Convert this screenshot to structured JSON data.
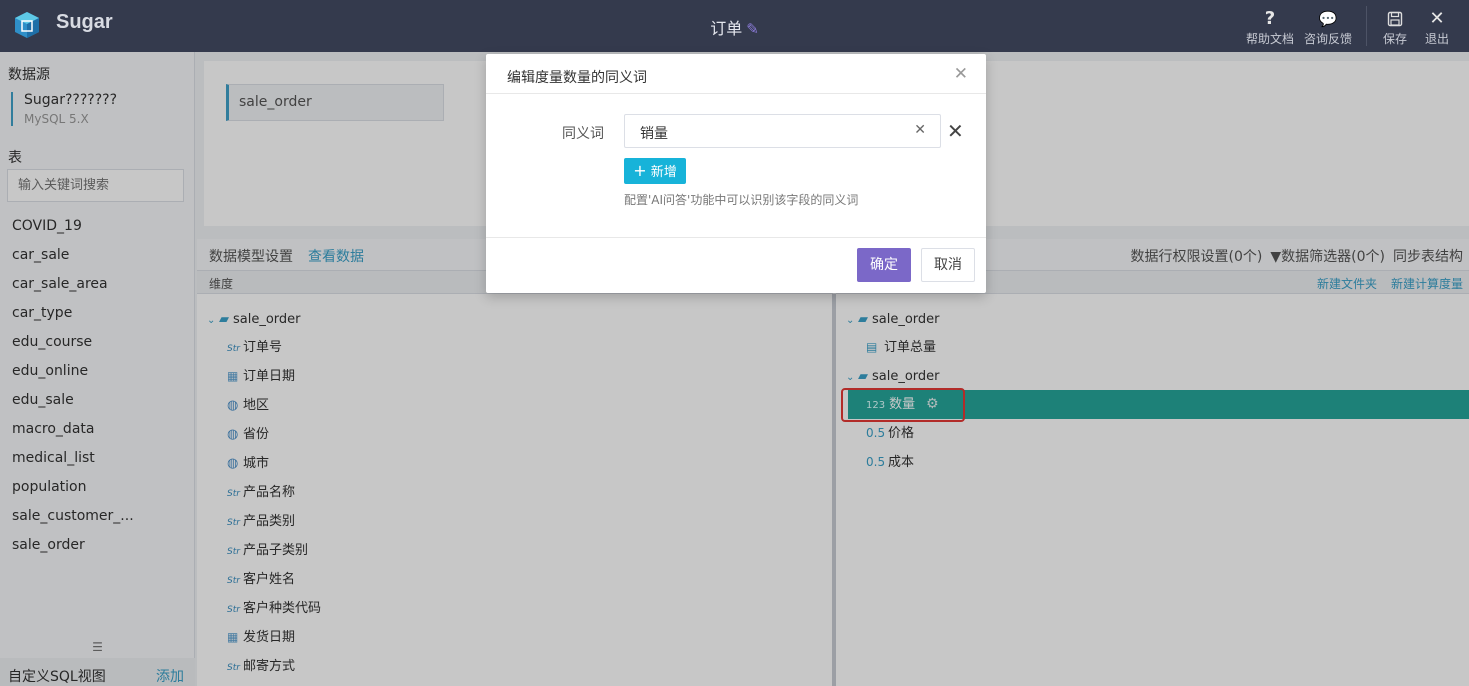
{
  "app": {
    "brand": "Sugar",
    "page_title": "订单"
  },
  "header_actions": [
    {
      "label": "帮助文档",
      "icon": "question-icon"
    },
    {
      "label": "咨询反馈",
      "icon": "chat-icon"
    },
    {
      "label": "保存",
      "icon": "save-icon"
    },
    {
      "label": "退出",
      "icon": "close-icon"
    }
  ],
  "sidebar": {
    "datasource_label": "数据源",
    "datasource_name": "Sugar???????",
    "datasource_type": "MySQL 5.X",
    "table_label": "表",
    "search_placeholder": "输入关键词搜索",
    "tables": [
      "COVID_19",
      "car_sale",
      "car_sale_area",
      "car_type",
      "edu_course",
      "edu_online",
      "edu_sale",
      "macro_data",
      "medical_list",
      "population",
      "sale_customer_...",
      "sale_order"
    ],
    "sql_view_label": "自定义SQL视图",
    "sql_view_add": "添加"
  },
  "canvas": {
    "table_chip": "sale_order"
  },
  "model_bar": {
    "title": "数据模型设置",
    "view_data": "查看数据",
    "row_permission": "数据行权限设置(0个)",
    "filter": "数据筛选器(0个)",
    "sync": "同步表结构"
  },
  "dimensions": {
    "header": "维度",
    "folder": "sale_order",
    "fields": [
      {
        "type": "str",
        "name": "订单号"
      },
      {
        "type": "date",
        "name": "订单日期"
      },
      {
        "type": "geo",
        "name": "地区"
      },
      {
        "type": "geo",
        "name": "省份"
      },
      {
        "type": "geo",
        "name": "城市"
      },
      {
        "type": "str",
        "name": "产品名称"
      },
      {
        "type": "str",
        "name": "产品类别"
      },
      {
        "type": "str",
        "name": "产品子类别"
      },
      {
        "type": "str",
        "name": "客户姓名"
      },
      {
        "type": "str",
        "name": "客户种类代码"
      },
      {
        "type": "date",
        "name": "发货日期"
      },
      {
        "type": "str",
        "name": "邮寄方式"
      }
    ]
  },
  "measures": {
    "new_folder": "新建文件夹",
    "new_calc": "新建计算度量",
    "folder1": "sale_order",
    "calc_field": "订单总量",
    "folder2": "sale_order",
    "selected_type": "123",
    "selected_field": "数量",
    "field_price_type": "0.5",
    "field_price": "价格",
    "field_cost_type": "0.5",
    "field_cost": "成本"
  },
  "modal": {
    "title": "编辑度量数量的同义词",
    "field_label": "同义词",
    "field_value": "销量",
    "add_button": "新增",
    "hint": "配置'AI问答'功能中可以识别该字段的同义词",
    "ok": "确定",
    "cancel": "取消"
  },
  "colors": {
    "topbar": "#343a4d",
    "accent": "#3aa0c8",
    "selected": "#26a69a",
    "primary_button": "#7b68c8",
    "add_button": "#17b3d9",
    "highlight": "#e53935"
  }
}
